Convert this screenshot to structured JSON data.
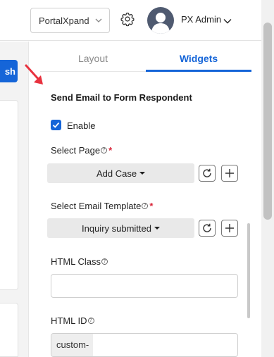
{
  "header": {
    "portal_select_value": "PortalXpand",
    "user_name": "PX Admin"
  },
  "left": {
    "publish_label": "sh"
  },
  "panel": {
    "tabs": [
      {
        "label": "Layout",
        "active": false
      },
      {
        "label": "Widgets",
        "active": true
      }
    ],
    "widget_title": "Send Email to Form Respondent",
    "enable": {
      "label": "Enable",
      "checked": true
    },
    "select_page": {
      "label": "Select Page",
      "required_mark": "*",
      "value": "Add Case"
    },
    "select_email_template": {
      "label": "Select Email Template",
      "required_mark": "*",
      "value": "Inquiry submitted"
    },
    "html_class": {
      "label": "HTML Class",
      "value": ""
    },
    "html_id": {
      "label": "HTML ID",
      "prefix": "custom-",
      "value": ""
    },
    "help_glyph": "?"
  },
  "colors": {
    "accent": "#1565d8",
    "required": "#d9263a",
    "annotation_arrow": "#e8323f"
  },
  "icons": [
    "chevron-down-icon",
    "gear-icon",
    "avatar-icon",
    "check-icon",
    "refresh-icon",
    "plus-icon",
    "help-icon",
    "arrow-annotation-icon"
  ]
}
